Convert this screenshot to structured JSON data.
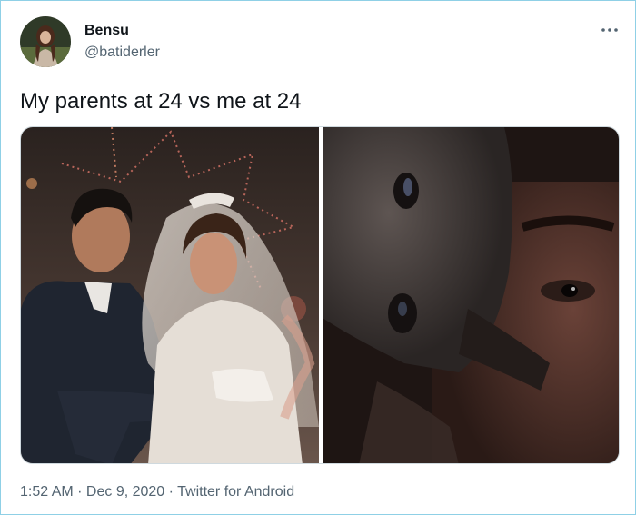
{
  "author": {
    "display_name": "Bensu",
    "handle": "@batiderler",
    "avatar_icon": "profile-photo-avatar"
  },
  "header": {
    "more_icon": "more-options-icon"
  },
  "tweet": {
    "text": "My parents at 24 vs me at 24"
  },
  "media": {
    "photos": [
      {
        "subject": "wedding-couple-photo"
      },
      {
        "subject": "cat-selfie-photo"
      }
    ]
  },
  "meta": {
    "time": "1:52 AM",
    "separator_1": " · ",
    "date": "Dec 9, 2020",
    "separator_2": " · ",
    "source": "Twitter for Android"
  },
  "colors": {
    "text_primary": "#0f1419",
    "text_secondary": "#536471",
    "frame_border": "#8fd0e6",
    "media_border": "#cfd9de"
  }
}
